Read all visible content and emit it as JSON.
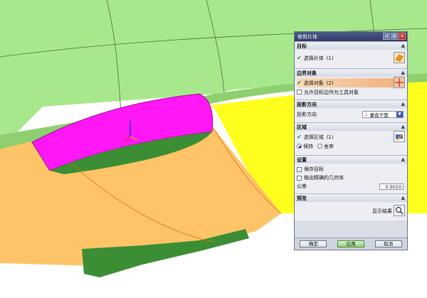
{
  "dialog": {
    "title": "修剪片体",
    "sections": {
      "target": {
        "header": "目标",
        "select_label": "选择片体",
        "select_count": "(1)"
      },
      "boundary": {
        "header": "边界对象",
        "select_label": "选择对象",
        "select_count": "(2)",
        "allow_label": "允许目标边作为工具对象"
      },
      "projection": {
        "header": "投影方向",
        "label": "投影方向",
        "value": "垂直于面"
      },
      "region": {
        "header": "区域",
        "select_label": "选择区域",
        "select_count": "(1)",
        "keep_label": "保持",
        "discard_label": "舍弃"
      },
      "settings": {
        "header": "设置",
        "save_target_label": "保存目标",
        "output_label": "输出精确的几何体",
        "tolerance_label": "公差",
        "tolerance_value": "0.0010"
      },
      "preview": {
        "header": "预览",
        "show_result_label": "显示结果"
      }
    },
    "buttons": {
      "ok": "确定",
      "apply": "应用",
      "cancel": "取消"
    }
  },
  "colors": {
    "surface_green": "#a8e88c",
    "surface_yellow": "#ffff1e",
    "surface_orange": "#ffc468",
    "magenta_face": "#ff18f5",
    "dark_green": "#3b8e33",
    "background": "#ffffff"
  }
}
